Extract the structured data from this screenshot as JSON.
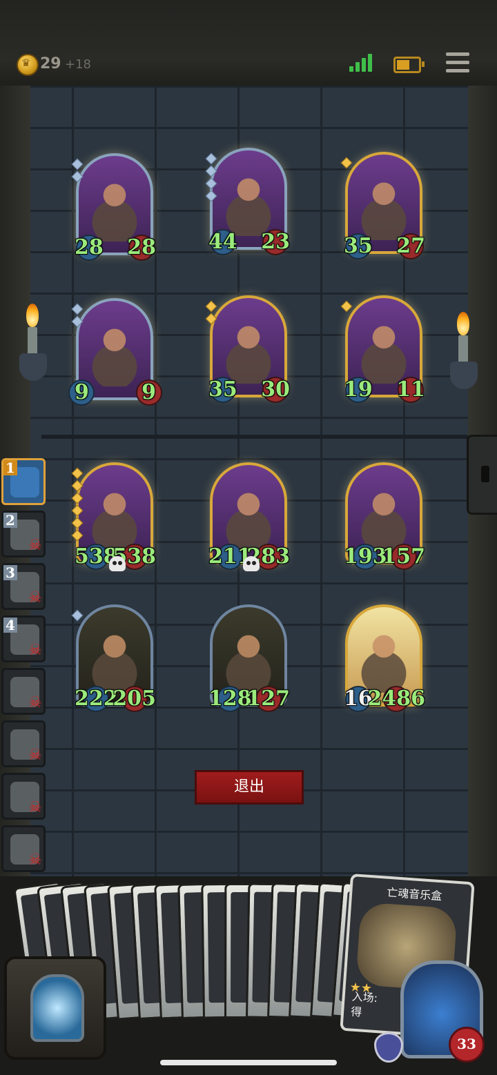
{
  "status_bar": {
    "gold": "29",
    "gold_income": "+18",
    "icons": [
      "coin-icon",
      "signal-icon",
      "battery-icon",
      "menu-icon"
    ]
  },
  "enemy_board": [
    {
      "attack": "28",
      "health": "28",
      "frame": "silver"
    },
    {
      "attack": "44",
      "health": "23",
      "frame": "silver"
    },
    {
      "attack": "35",
      "health": "27",
      "frame": "gold"
    },
    {
      "attack": "9",
      "health": "9",
      "frame": "silver"
    },
    {
      "attack": "35",
      "health": "30",
      "frame": "gold"
    },
    {
      "attack": "19",
      "health": "11",
      "frame": "gold"
    }
  ],
  "player_board": [
    {
      "attack": "538",
      "health": "538",
      "frame": "gold"
    },
    {
      "attack": "211",
      "health": "283",
      "frame": "gold"
    },
    {
      "attack": "193",
      "health": "157",
      "frame": "gold"
    },
    {
      "attack": "222",
      "health": "205",
      "frame": "silver"
    },
    {
      "attack": "128",
      "health": "127",
      "frame": "silver"
    },
    {
      "attack": "16",
      "health": "2486",
      "frame": "gold"
    }
  ],
  "exit_button": "退出",
  "queue": [
    {
      "num": "1",
      "active": true
    },
    {
      "num": "2",
      "active": false
    },
    {
      "num": "3",
      "active": false
    },
    {
      "num": "4",
      "active": false
    },
    {
      "num": "",
      "active": false
    },
    {
      "num": "",
      "active": false
    },
    {
      "num": "",
      "active": false
    },
    {
      "num": "",
      "active": false
    }
  ],
  "hand": {
    "featured_card_title": "亡魂音乐盒",
    "featured_card_text_1": "入场:",
    "featured_card_text_2": "得"
  },
  "hero": {
    "health": "33"
  }
}
